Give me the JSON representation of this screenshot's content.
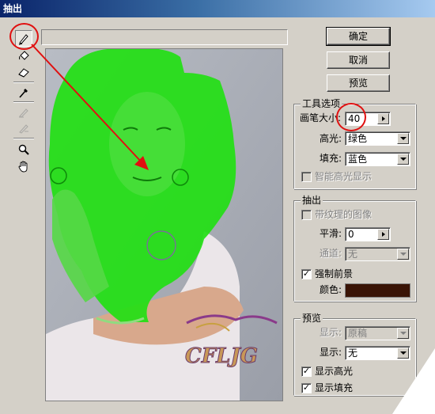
{
  "window": {
    "title": "抽出"
  },
  "toolbar": {
    "tools": [
      {
        "name": "edge-highlighter-icon",
        "state": "active"
      },
      {
        "name": "fill-bucket-icon",
        "state": "normal"
      },
      {
        "name": "eraser-icon",
        "state": "normal"
      },
      {
        "name": "eyedropper-icon",
        "state": "normal"
      },
      {
        "name": "cleanup-tool-icon",
        "state": "disabled"
      },
      {
        "name": "edge-touchup-icon",
        "state": "disabled"
      },
      {
        "name": "zoom-icon",
        "state": "normal"
      },
      {
        "name": "hand-icon",
        "state": "normal"
      }
    ]
  },
  "buttons": {
    "ok": "确定",
    "cancel": "取消",
    "preview": "预览"
  },
  "tool_options": {
    "title": "工具选项",
    "brush_size_label": "画笔大小:",
    "brush_size_value": "40",
    "highlight_label": "高光:",
    "highlight_value": "绿色",
    "fill_label": "填充:",
    "fill_value": "蓝色",
    "smart_highlight_label": "智能高光显示",
    "smart_highlight_checked": false
  },
  "extraction": {
    "title": "抽出",
    "textured_label": "带纹理的图像",
    "textured_checked": false,
    "smooth_label": "平滑:",
    "smooth_value": "0",
    "channel_label": "通道:",
    "channel_value": "无",
    "force_fg_label": "强制前景",
    "force_fg_checked": true,
    "color_label": "颜色:",
    "color_value": "#3a1406"
  },
  "preview_group": {
    "title": "预览",
    "show_label": "显示:",
    "show_value": "原稿",
    "display_label": "显示:",
    "display_value": "无",
    "show_highlight_label": "显示高光",
    "show_highlight_checked": true,
    "show_fill_label": "显示填充",
    "show_fill_checked": true
  },
  "watermark": {
    "text": "CFLJG"
  },
  "colors": {
    "highlight_green": "#22e014",
    "annotation_red": "#e01010",
    "dialog_face": "#d4d0c8",
    "title_bar": "#0a246a"
  }
}
